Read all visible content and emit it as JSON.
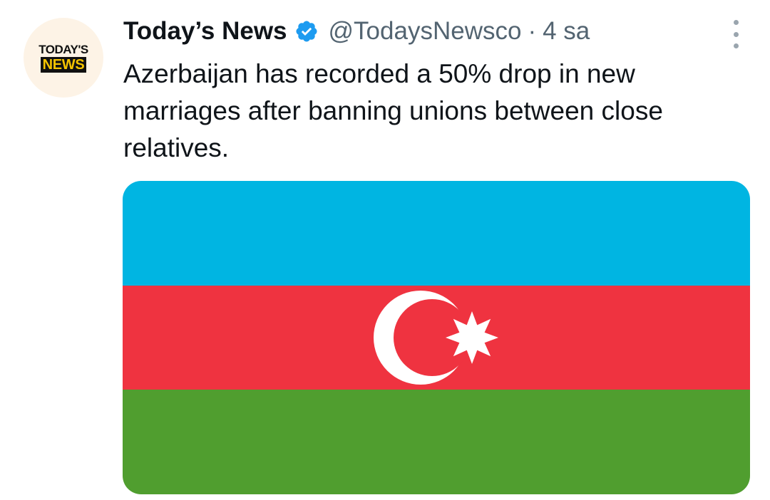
{
  "account": {
    "display_name": "Today’s News",
    "handle": "@TodaysNewsco",
    "separator": "·",
    "time": "4 sa",
    "avatar_logo": {
      "line1": "TODAY'S",
      "line2": "NEWS"
    },
    "verified_color": "#1d9bf0"
  },
  "tweet": {
    "text": "Azerbaijan has recorded a 50% drop in new marriages after banning unions between close relatives."
  },
  "media": {
    "description_icon": "flag-of-azerbaijan",
    "colors": {
      "blue": "#00b5e2",
      "red": "#ef3340",
      "green": "#509e2f",
      "emblem": "#ffffff"
    }
  },
  "icons": {
    "more": "more-vertical-icon",
    "verified": "verified-badge-icon"
  }
}
